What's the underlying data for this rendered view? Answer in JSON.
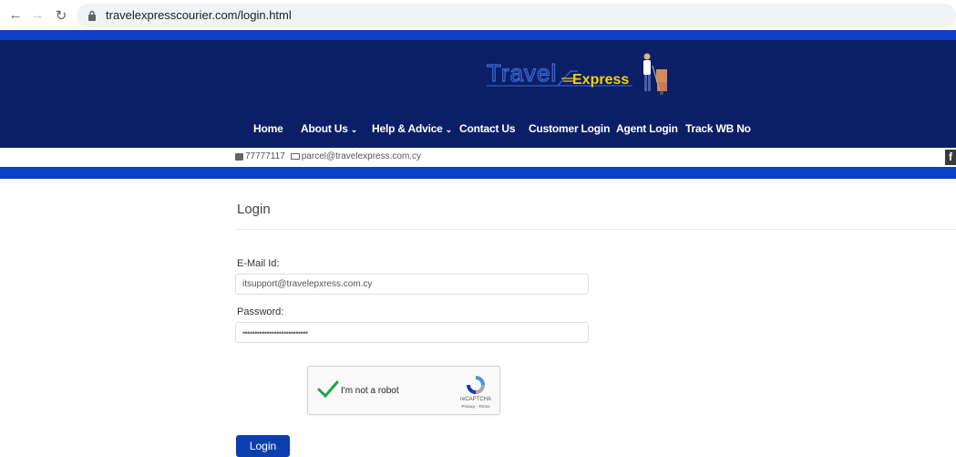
{
  "browser": {
    "url": "travelexpresscourier.com/login.html"
  },
  "logo": {
    "word1": "Travel",
    "word2": "Express"
  },
  "nav": {
    "home": "Home",
    "about": "About Us",
    "help": "Help & Advice",
    "contact": "Contact Us",
    "customer_login": "Customer Login",
    "agent_login": "Agent Login",
    "track": "Track WB No"
  },
  "contact_bar": {
    "phone": "77777117",
    "email": "parcel@travelexpress.com.cy",
    "social": "f"
  },
  "login": {
    "title": "Login",
    "email_label": "E-Mail Id:",
    "email_value": "itsupport@travelepxress.com.cy",
    "password_label": "Password:",
    "password_value": "•••••••••••••••••••••••••••",
    "button": "Login"
  },
  "captcha": {
    "label": "I'm not a robot",
    "brand": "reCAPTCHA",
    "terms": "Privacy - Terms"
  },
  "colors": {
    "header_bg": "#0b1f66",
    "strip_blue": "#0b3fc7",
    "button_blue": "#0b3fb0",
    "logo_yellow": "#f5d000"
  }
}
